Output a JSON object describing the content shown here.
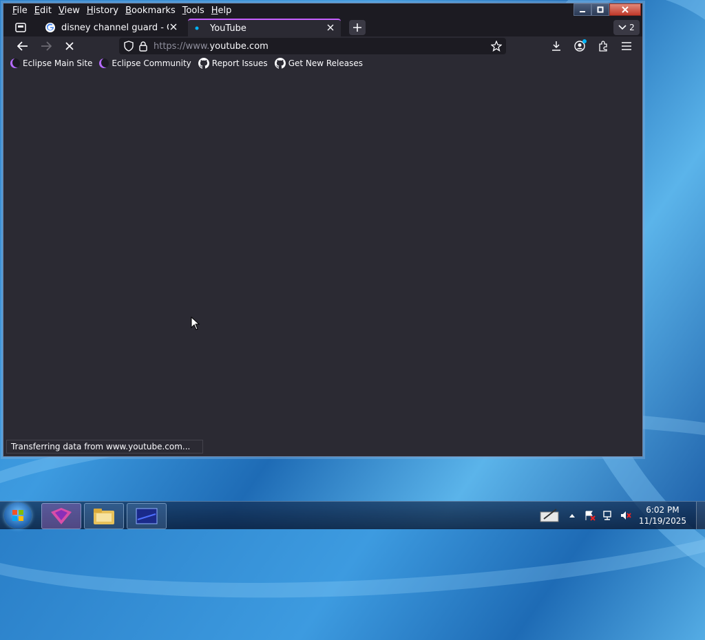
{
  "menubar": {
    "items": [
      {
        "label": "File",
        "key": "F",
        "rest": "ile"
      },
      {
        "label": "Edit",
        "key": "E",
        "rest": "dit"
      },
      {
        "label": "View",
        "key": "V",
        "rest": "iew"
      },
      {
        "label": "History",
        "key": "H",
        "rest": "istory"
      },
      {
        "label": "Bookmarks",
        "key": "B",
        "rest": "ookmarks"
      },
      {
        "label": "Tools",
        "key": "T",
        "rest": "ools"
      },
      {
        "label": "Help",
        "key": "H",
        "rest": "elp"
      }
    ]
  },
  "tabs": [
    {
      "label": "disney channel guard - Google S",
      "favicon": "google-icon",
      "active": false
    },
    {
      "label": "YouTube",
      "favicon": "loading-dot-icon",
      "active": true
    }
  ],
  "tab_count": "2",
  "navbar": {
    "url_prefix": "https://www.",
    "url_domain": "youtube.com"
  },
  "bookmarks": [
    {
      "label": "Eclipse Main Site",
      "icon": "eclipse-icon"
    },
    {
      "label": "Eclipse Community",
      "icon": "eclipse-icon"
    },
    {
      "label": "Report Issues",
      "icon": "github-icon"
    },
    {
      "label": "Get New Releases",
      "icon": "github-icon"
    }
  ],
  "status_text": "Transferring data from www.youtube.com...",
  "taskbar": {
    "time": "6:02 PM",
    "date": "11/19/2025"
  },
  "colors": {
    "accent": "#c660ff",
    "toolbar_bg": "#2b2a33",
    "frame_bg": "#1c1b22"
  }
}
